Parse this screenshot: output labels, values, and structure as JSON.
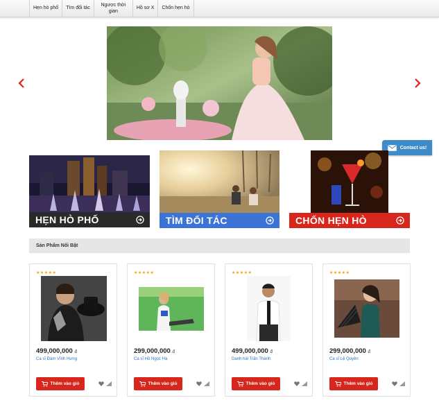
{
  "nav": {
    "items": [
      {
        "label": "Hẹn hò phố"
      },
      {
        "label": "Tìm đối tác"
      },
      {
        "label": "Ngược thời gian"
      },
      {
        "label": "Hồ sơ X"
      },
      {
        "label": "Chốn hẹn hò"
      }
    ]
  },
  "contact": {
    "label": "Contact us!"
  },
  "categories": [
    {
      "label": "HẸN HÒ PHỐ",
      "color": "#2a2a2a"
    },
    {
      "label": "TÌM ĐỐI TÁC",
      "color": "#3b73d6"
    },
    {
      "label": "CHỐN HẸN HÒ",
      "color": "#d9261c"
    }
  ],
  "section": {
    "title": "Sản Phẩm Nổi Bật"
  },
  "products": [
    {
      "stars": "★★★★★",
      "price": "499,000,000",
      "currency": "đ",
      "name": "Ca sĩ Đàm Vĩnh Hưng",
      "cart_label": "Thêm vào giỏ"
    },
    {
      "stars": "★★★★★",
      "price": "299,000,000",
      "currency": "đ",
      "name": "Ca sĩ Hồ Ngọc Hà",
      "cart_label": "Thêm vào giỏ"
    },
    {
      "stars": "★★★★★",
      "price": "499,000,000",
      "currency": "đ",
      "name": "Danh hài Trấn Thành",
      "cart_label": "Thêm vào giỏ"
    },
    {
      "stars": "★★★★★",
      "price": "299,000,000",
      "currency": "đ",
      "name": "Ca sĩ Lệ Quyên",
      "cart_label": "Thêm vào giỏ"
    }
  ],
  "icons": {
    "prev": "chevron-left-icon",
    "next": "chevron-right-icon",
    "contact": "envelope-icon",
    "category_go": "arrow-circle-right-icon",
    "cart": "shopping-cart-icon",
    "wishlist": "heart-icon",
    "compare": "bar-chart-icon"
  },
  "colors": {
    "accent_red": "#d9261c",
    "link_blue": "#2b72c0",
    "star": "#f0a500",
    "contact_blue": "#3d8bc9"
  }
}
